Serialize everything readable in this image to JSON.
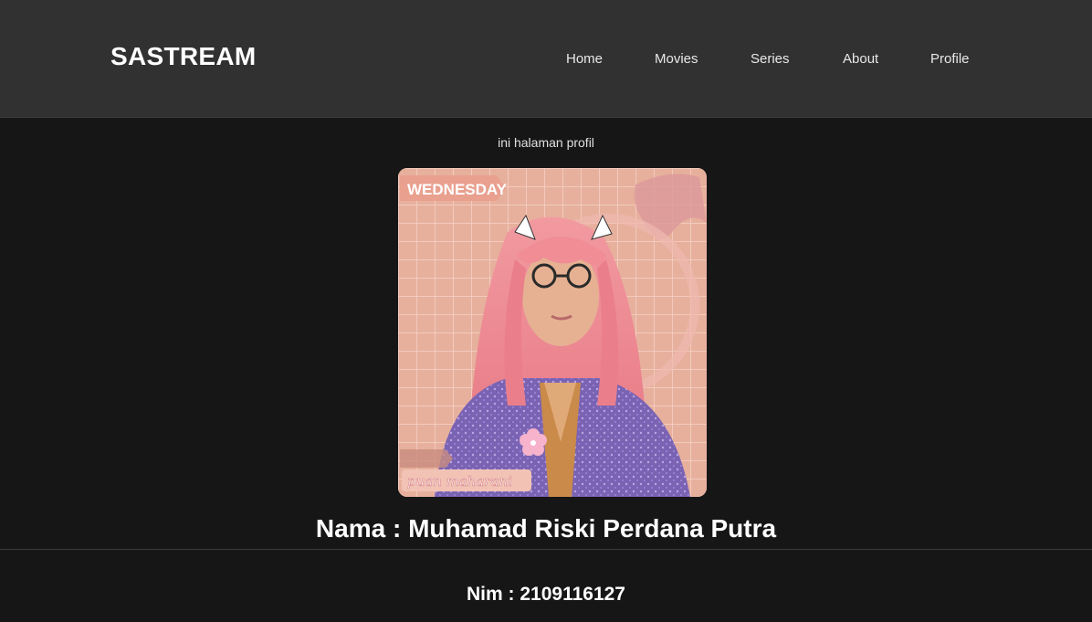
{
  "header": {
    "brand": "SASTREAM",
    "nav": [
      "Home",
      "Movies",
      "Series",
      "About",
      "Profile"
    ]
  },
  "main": {
    "caption": "ini halaman profil",
    "photo": {
      "top_label": "WEDNESDAY",
      "bottom_label": "puan maharani"
    },
    "name_line": "Nama : Muhamad Riski Perdana Putra"
  },
  "footer": {
    "nim_line": "Nim : 2109116127"
  },
  "colors": {
    "navbar_bg": "#313131",
    "page_bg": "#161616",
    "photo_bg": "#e7b09d",
    "hair": "#ef8a92"
  }
}
